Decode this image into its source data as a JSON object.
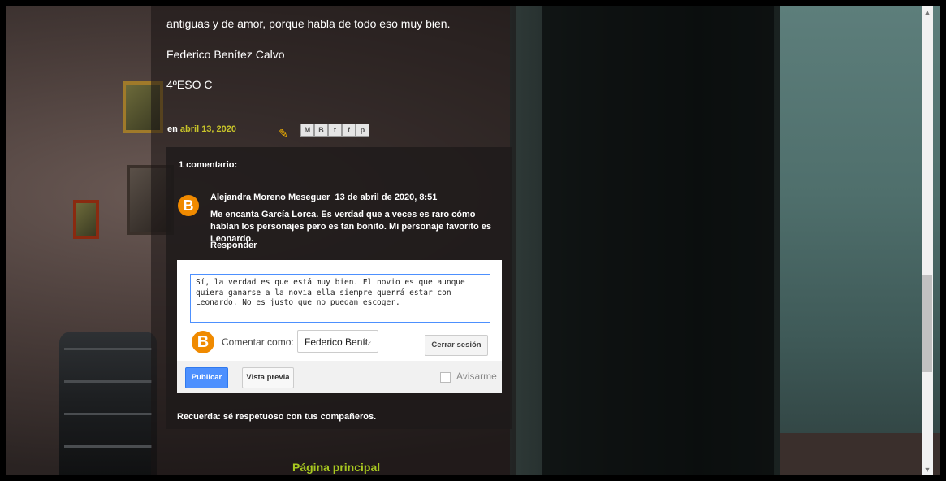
{
  "post": {
    "text_line": "antiguas y de amor, porque habla de todo eso muy bien.",
    "author_line": "Federico Benítez Calvo",
    "class_line": "4ºESO C",
    "meta_prefix": "en",
    "date": "abril 13, 2020",
    "share_icons": [
      "M",
      "B",
      "t",
      "f",
      "p"
    ]
  },
  "comments": {
    "title": "1 comentario:",
    "items": [
      {
        "author": "Alejandra Moreno Meseguer",
        "timestamp": "13 de abril de 2020, 8:51",
        "text": "Me encanta García Lorca. Es verdad que a veces es raro cómo hablan los personajes pero es tan bonito. Mi personaje favorito es Leonardo.",
        "reply_label": "Responder"
      }
    ]
  },
  "form": {
    "textarea_value": "Sí, la verdad es que está muy bien. El novio es que aunque quiera ganarse a la novia ella siempre querrá estar con Leonardo. No es justo que no puedan escoger.",
    "comment_as_label": "Comentar como:",
    "selected_account": "Federico Benít",
    "logout_label": "Cerrar sesión",
    "publish_label": "Publicar",
    "preview_label": "Vista previa",
    "notify_label": "Avisarme"
  },
  "reminder": "Recuerda: sé respetuoso con tus compañeros.",
  "home_link": "Página principal",
  "colors": {
    "link": "#c8c42a",
    "blogger_orange": "#f08a00",
    "publish_blue": "#4d90fe",
    "home_link": "#a8c820"
  }
}
